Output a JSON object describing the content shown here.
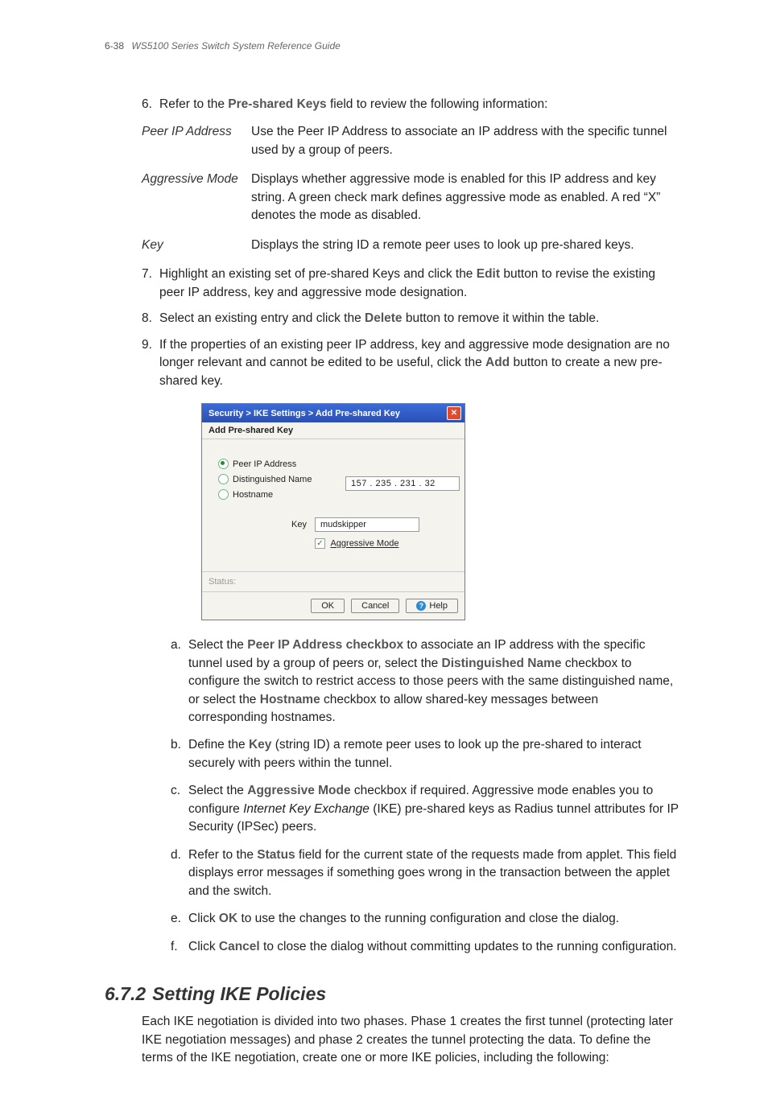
{
  "header": {
    "pagenum": "6-38",
    "title": "WS5100 Series Switch System Reference Guide"
  },
  "steps": {
    "s6": {
      "num": "6.",
      "pre": "Refer to the ",
      "term": "Pre-shared Keys",
      "post": " field to review the following information:"
    },
    "s7": {
      "num": "7.",
      "pre": "Highlight an existing set of pre-shared Keys and click the ",
      "term": "Edit",
      "post": " button to revise the existing peer IP address, key and aggressive mode designation."
    },
    "s8": {
      "num": "8.",
      "pre": "Select an existing entry and click the ",
      "term": "Delete",
      "post": " button to remove it within the table."
    },
    "s9": {
      "num": "9.",
      "pre": "If the properties of an existing peer IP address, key and aggressive mode designation are no longer relevant and cannot be edited to be useful, click the ",
      "term": "Add",
      "post": " button to create a new pre-shared key."
    }
  },
  "defs": {
    "peer": {
      "term": "Peer IP Address",
      "desc": "Use the Peer IP Address to associate an IP address with the specific tunnel used by a group of peers."
    },
    "agg": {
      "term": "Aggressive Mode",
      "desc": "Displays whether aggressive mode is enabled for this IP address and key string. A green check mark defines aggressive mode as enabled. A red “X” denotes the mode as disabled."
    },
    "key": {
      "term": "Key",
      "desc": "Displays the string ID a remote peer uses to look up pre-shared keys."
    }
  },
  "dialog": {
    "crumbs": "Security > IKE Settings > Add Pre-shared Key",
    "subhead": "Add Pre-shared Key",
    "radio_peer": "Peer IP Address",
    "radio_dn": "Distinguished Name",
    "radio_host": "Hostname",
    "ip_value": "157 . 235 . 231 .  32",
    "key_label": "Key",
    "key_value": "mudskipper",
    "agg_label": "Aggressive Mode",
    "status_label": "Status:",
    "btn_ok": "OK",
    "btn_cancel": "Cancel",
    "btn_help": "Help"
  },
  "sub": {
    "a": {
      "let": "a.",
      "p1": "Select the ",
      "t1": "Peer IP Address checkbox",
      "p2": " to associate an IP address with the specific tunnel used by a group of peers or, select the ",
      "t2": "Distinguished Name",
      "p3": " checkbox to configure the switch to restrict access to those peers with the same distinguished name, or select the ",
      "t3": "Hostname",
      "p4": " checkbox to allow shared-key messages between corresponding hostnames."
    },
    "b": {
      "let": "b.",
      "p1": "Define the ",
      "t1": "Key",
      "p2": " (string ID) a remote peer uses to look up the pre-shared to interact securely with peers within the tunnel."
    },
    "c": {
      "let": "c.",
      "p1": "Select the ",
      "t1": "Aggressive Mode",
      "p2": " checkbox if required. Aggressive mode enables you to configure ",
      "it": "Internet Key Exchange",
      "p3": " (IKE) pre-shared keys as Radius tunnel attributes for IP Security (IPSec) peers."
    },
    "d": {
      "let": "d.",
      "p1": "Refer to the ",
      "t1": "Status",
      "p2": " field for the current state of the requests made from applet. This field displays error messages if something goes wrong in the transaction between the applet and the switch."
    },
    "e": {
      "let": "e.",
      "p1": "Click ",
      "t1": "OK",
      "p2": " to use the changes to the running configuration and close the dialog."
    },
    "f": {
      "let": "f.",
      "p1": "Click ",
      "t1": "Cancel",
      "p2": " to close the dialog without committing updates to the running configuration."
    }
  },
  "section": {
    "num": "6.7.2",
    "title": "Setting IKE Policies",
    "body": "Each IKE negotiation is divided into two phases. Phase 1 creates the first tunnel (protecting later IKE negotiation messages) and phase 2 creates the tunnel protecting the data. To define the terms of the IKE negotiation, create one or more IKE policies, including the following:"
  }
}
